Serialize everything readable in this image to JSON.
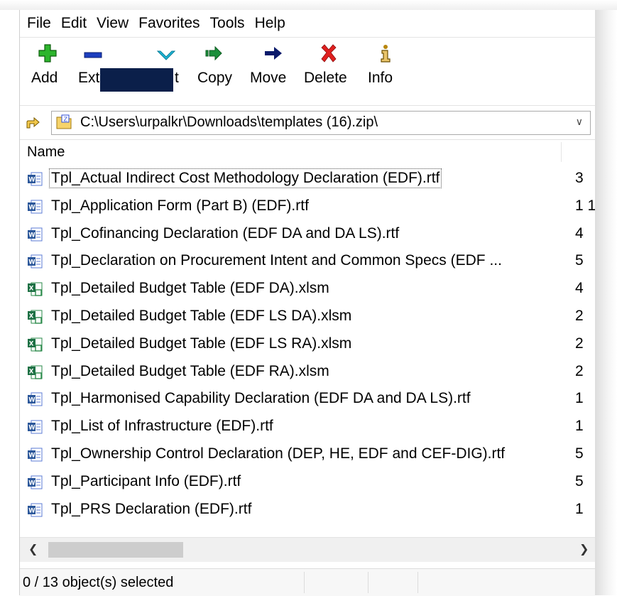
{
  "menu": [
    "File",
    "Edit",
    "View",
    "Favorites",
    "Tools",
    "Help"
  ],
  "toolbar": {
    "add": "Add",
    "extract_visible": "Ext",
    "test_visible": "t",
    "copy": "Copy",
    "move": "Move",
    "delete": "Delete",
    "info": "Info"
  },
  "address": {
    "path": "C:\\Users\\urpalkr\\Downloads\\templates (16).zip\\"
  },
  "list": {
    "column_name": "Name",
    "files": [
      {
        "name": "Tpl_Actual Indirect Cost Methodology Declaration (EDF).rtf",
        "type": "word",
        "size": "3"
      },
      {
        "name": "Tpl_Application Form (Part B) (EDF).rtf",
        "type": "word",
        "size": "1 1"
      },
      {
        "name": "Tpl_Cofinancing Declaration (EDF DA and DA LS).rtf",
        "type": "word",
        "size": "4"
      },
      {
        "name": "Tpl_Declaration on Procurement Intent and Common Specs (EDF ...",
        "type": "word",
        "size": "5"
      },
      {
        "name": "Tpl_Detailed Budget Table (EDF DA).xlsm",
        "type": "excel",
        "size": "4"
      },
      {
        "name": "Tpl_Detailed Budget Table (EDF LS DA).xlsm",
        "type": "excel",
        "size": "2"
      },
      {
        "name": "Tpl_Detailed Budget Table (EDF LS RA).xlsm",
        "type": "excel",
        "size": "2"
      },
      {
        "name": "Tpl_Detailed Budget Table (EDF RA).xlsm",
        "type": "excel",
        "size": "2"
      },
      {
        "name": "Tpl_Harmonised Capability Declaration (EDF DA and DA LS).rtf",
        "type": "word",
        "size": "1"
      },
      {
        "name": "Tpl_List of Infrastructure (EDF).rtf",
        "type": "word",
        "size": "1"
      },
      {
        "name": "Tpl_Ownership Control Declaration (DEP, HE, EDF and CEF-DIG).rtf",
        "type": "word",
        "size": "5"
      },
      {
        "name": "Tpl_Participant Info (EDF).rtf",
        "type": "word",
        "size": "5"
      },
      {
        "name": "Tpl_PRS Declaration (EDF).rtf",
        "type": "word",
        "size": "1"
      }
    ]
  },
  "status": {
    "selection": "0 / 13 object(s) selected"
  },
  "colors": {
    "add_green": "#2db52d",
    "extract_blue": "#1d3fbf",
    "test_cyan": "#1fb6d6",
    "copy_green": "#1a8f3a",
    "move_navy": "#0a1a6b",
    "delete_red": "#e0201f",
    "info_gold": "#b8860b",
    "redaction": "#0b1f4a"
  }
}
